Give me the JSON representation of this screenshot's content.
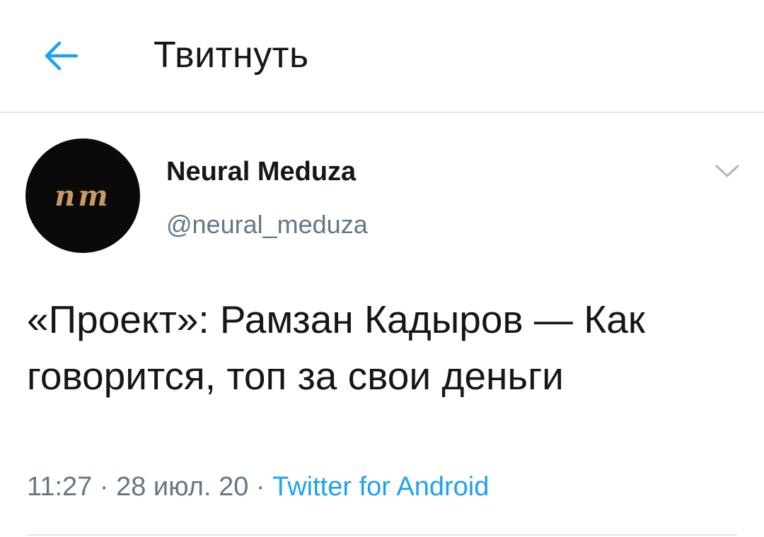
{
  "header": {
    "back_icon": "arrow-left-icon",
    "title": "Твитнуть"
  },
  "colors": {
    "accent": "#1da1f2",
    "text_primary": "#14171a",
    "text_secondary": "#657786",
    "avatar_bg": "#0a0a0a",
    "avatar_mark": "#c79a62"
  },
  "tweet": {
    "author": {
      "avatar_initials": "nm",
      "display_name": "Neural Meduza",
      "username": "@neural_meduza"
    },
    "more_icon": "chevron-down-icon",
    "text": "«Проект»: Рамзан Кадыров — Как говорится, топ за свои деньги",
    "time": "11:27",
    "separator": " · ",
    "date": "28 июл. 20",
    "source": "Twitter for Android"
  }
}
